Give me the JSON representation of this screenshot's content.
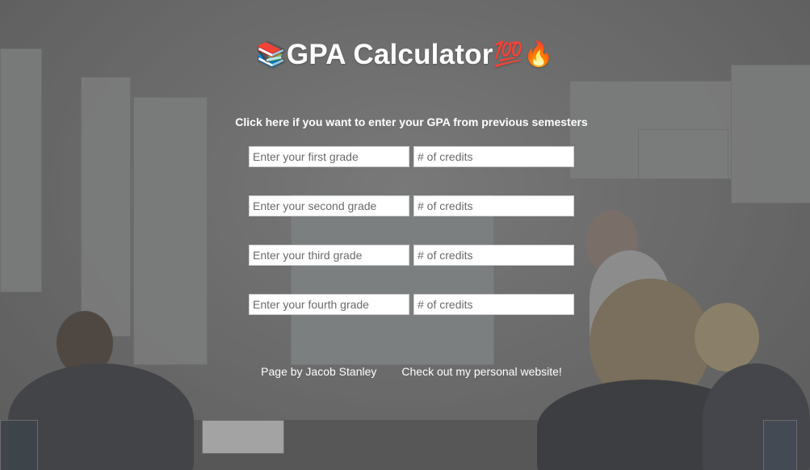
{
  "header": {
    "icon_left": "books-emoji",
    "title": "GPA Calculator",
    "icon_right_1": "hundred-points-emoji",
    "icon_right_2": "fire-emoji"
  },
  "previous_semesters_link": "Click here if you want to enter your GPA from previous semesters",
  "grade_rows": [
    {
      "grade_placeholder": "Enter your first grade",
      "credits_placeholder": "# of credits"
    },
    {
      "grade_placeholder": "Enter your second grade",
      "credits_placeholder": "# of credits"
    },
    {
      "grade_placeholder": "Enter your third grade",
      "credits_placeholder": "# of credits"
    },
    {
      "grade_placeholder": "Enter your fourth grade",
      "credits_placeholder": "# of credits"
    }
  ],
  "footer": {
    "author": "Page by Jacob Stanley",
    "website_link": "Check out my personal website!"
  }
}
